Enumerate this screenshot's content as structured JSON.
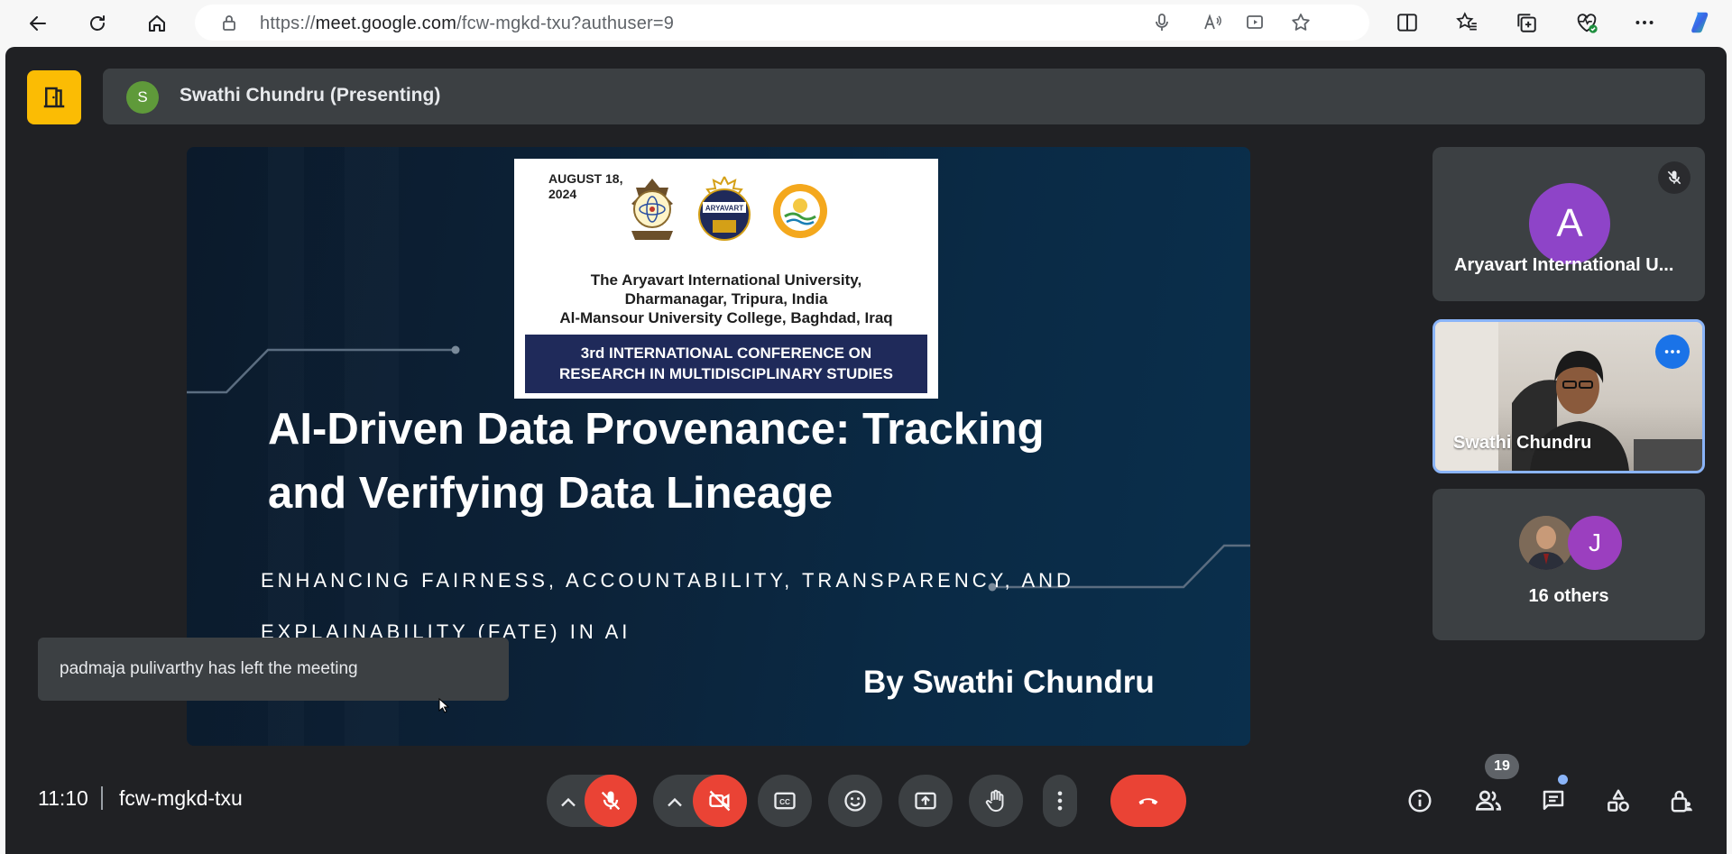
{
  "browser": {
    "url_prefix": "https://",
    "url_host": "meet.google.com",
    "url_path": "/fcw-mgkd-txu?authuser=9"
  },
  "meeting": {
    "presenter_initial": "S",
    "presenter_label": "Swathi Chundru (Presenting)",
    "time": "11:10",
    "code": "fcw-mgkd-txu",
    "participant_count": "19"
  },
  "slide": {
    "date_line1": "AUGUST 18,",
    "date_line2": "2024",
    "logo2_text": "ARYAVART",
    "uni_line1": "The Aryavart International University,",
    "uni_line2": "Dharmanagar, Tripura, India",
    "uni_line3": "Al-Mansour University College, Baghdad, Iraq",
    "conf_line1": "3rd INTERNATIONAL CONFERENCE ON",
    "conf_line2": "RESEARCH IN MULTIDISCIPLINARY STUDIES",
    "title_line1": "AI-Driven Data Provenance: Tracking",
    "title_line2": "and Verifying Data Lineage",
    "subtitle_line1": "ENHANCING FAIRNESS, ACCOUNTABILITY, TRANSPARENCY, AND",
    "subtitle_line2": "EXPLAINABILITY (FATE) IN AI",
    "author": "By Swathi Chundru"
  },
  "participants": {
    "tile1_initial": "A",
    "tile1_name": "Aryavart International U...",
    "tile2_name": "Swathi Chundru",
    "tile3_initial": "J",
    "others_label": "16 others"
  },
  "toast": {
    "message": "padmaja pulivarthy has left the meeting"
  },
  "colors": {
    "meet_bg": "#202124",
    "tile_bg": "#3c4043",
    "end_call": "#ea4335",
    "leave_tile": "#fbbc04",
    "avatar_a": "#8e44c8",
    "avatar_s": "#5f9a3a",
    "active_border": "#8ab4f8"
  }
}
